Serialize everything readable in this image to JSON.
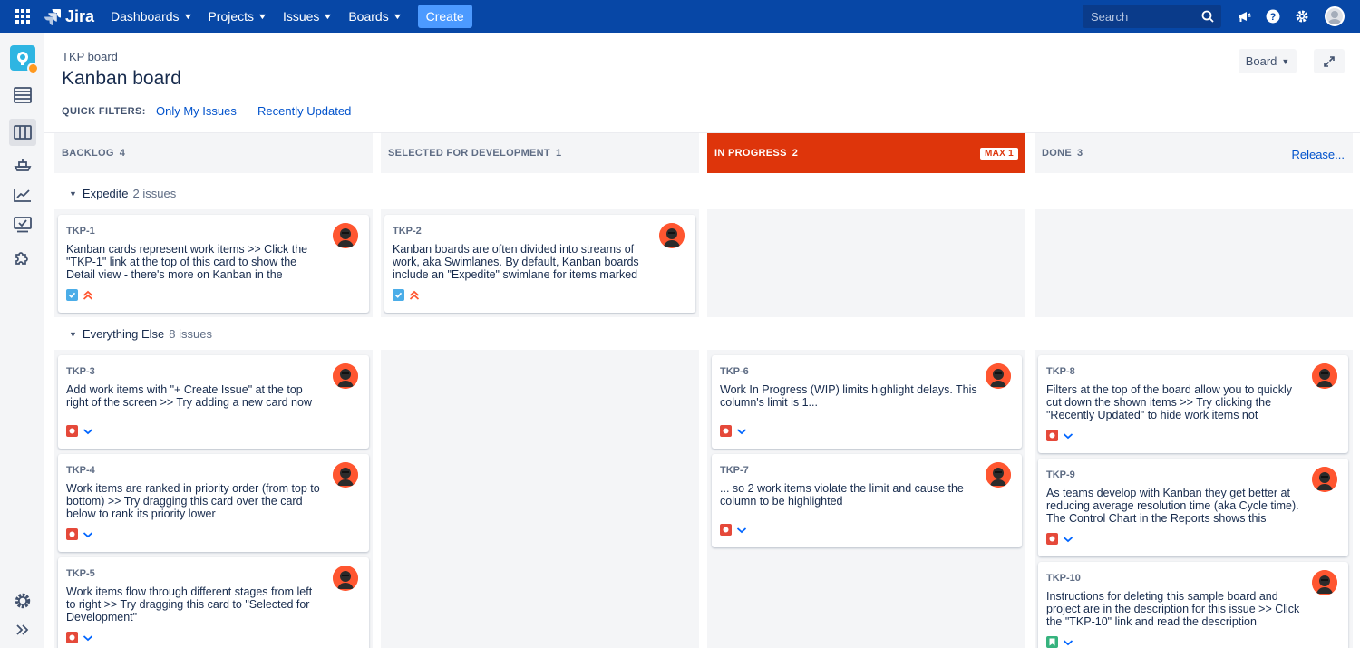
{
  "nav": {
    "logo": "Jira",
    "items": [
      "Dashboards",
      "Projects",
      "Issues",
      "Boards"
    ],
    "create_label": "Create",
    "search_placeholder": "Search"
  },
  "header": {
    "breadcrumb": "TKP board",
    "title": "Kanban board",
    "quick_filters_label": "QUICK FILTERS:",
    "quick_filters": [
      "Only My Issues",
      "Recently Updated"
    ],
    "board_button": "Board"
  },
  "columns": [
    {
      "name": "BACKLOG",
      "count": "4"
    },
    {
      "name": "SELECTED FOR DEVELOPMENT",
      "count": "1"
    },
    {
      "name": "IN PROGRESS",
      "count": "2",
      "max": "MAX 1"
    },
    {
      "name": "DONE",
      "count": "3",
      "release": "Release..."
    }
  ],
  "swimlanes": [
    {
      "name": "Expedite",
      "count": "2 issues"
    },
    {
      "name": "Everything Else",
      "count": "8 issues"
    }
  ],
  "cards": {
    "tkp1": {
      "key": "TKP-1",
      "summary": "Kanban cards represent work items >> Click the \"TKP-1\" link at the top of this card to show the Detail view - there's more on Kanban in the",
      "type": "task",
      "priority": "highest"
    },
    "tkp2": {
      "key": "TKP-2",
      "summary": "Kanban boards are often divided into streams of work, aka Swimlanes. By default, Kanban boards include an \"Expedite\" swimlane for items marked",
      "type": "task",
      "priority": "highest"
    },
    "tkp3": {
      "key": "TKP-3",
      "summary": "Add work items with \"+ Create Issue\" at the top right of the screen >> Try adding a new card now",
      "type": "bug",
      "priority": "low"
    },
    "tkp4": {
      "key": "TKP-4",
      "summary": "Work items are ranked in priority order (from top to bottom) >> Try dragging this card over the card below to rank its priority lower",
      "type": "bug",
      "priority": "low"
    },
    "tkp5": {
      "key": "TKP-5",
      "summary": "Work items flow through different stages from left to right >> Try dragging this card to \"Selected for Development\"",
      "type": "bug",
      "priority": "low"
    },
    "tkp6": {
      "key": "TKP-6",
      "summary": "Work In Progress (WIP) limits highlight delays. This column's limit is 1...",
      "type": "bug",
      "priority": "low"
    },
    "tkp7": {
      "key": "TKP-7",
      "summary": "... so 2 work items violate the limit and cause the column to be highlighted",
      "type": "bug",
      "priority": "low"
    },
    "tkp8": {
      "key": "TKP-8",
      "summary": "Filters at the top of the board allow you to quickly cut down the shown items >> Try clicking the \"Recently Updated\" to hide work items not",
      "type": "bug",
      "priority": "low"
    },
    "tkp9": {
      "key": "TKP-9",
      "summary": "As teams develop with Kanban they get better at reducing average resolution time (aka Cycle time). The Control Chart in the Reports shows this",
      "type": "bug",
      "priority": "low"
    },
    "tkp10": {
      "key": "TKP-10",
      "summary": "Instructions for deleting this sample board and project are in the description for this issue >> Click the \"TKP-10\" link and read the description",
      "type": "story",
      "priority": "low"
    }
  },
  "colors": {
    "nav_bg": "#0747a6",
    "create_bg": "#4c9aff",
    "over_limit": "#de350b",
    "link": "#0052cc",
    "column_bg": "#f4f5f7"
  }
}
